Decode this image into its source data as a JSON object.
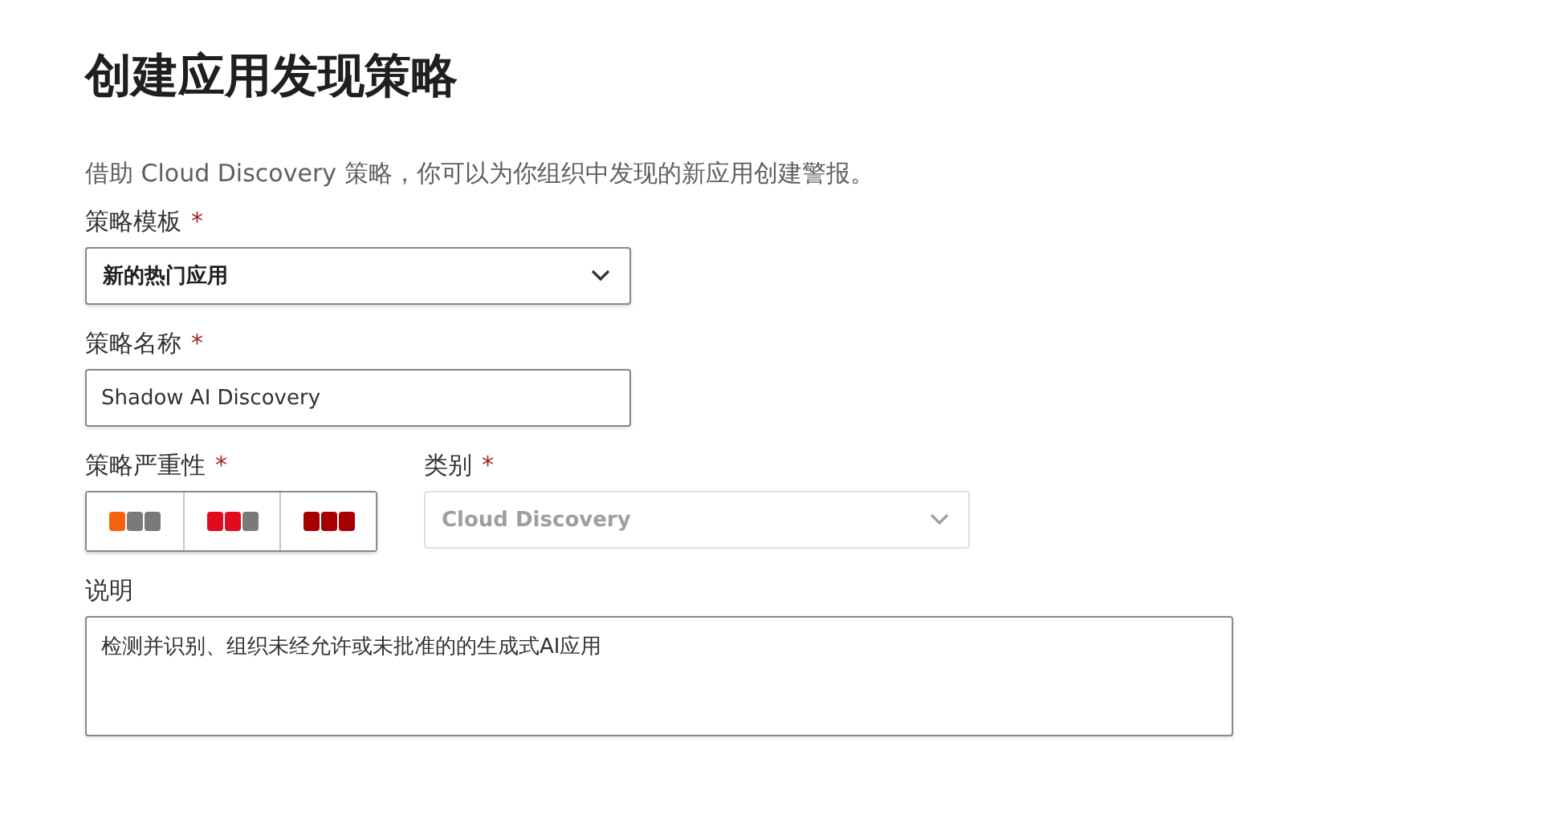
{
  "title": "创建应用发现策略",
  "intro": "借助 Cloud Discovery 策略，你可以为你组织中发现的新应用创建警报。",
  "template": {
    "label": "策略模板",
    "required_mark": "*",
    "value": "新的热门应用"
  },
  "name": {
    "label": "策略名称",
    "required_mark": "*",
    "value": "Shadow AI Discovery"
  },
  "severity": {
    "label": "策略严重性",
    "required_mark": "*",
    "options": [
      {
        "kind": "low",
        "selected": false
      },
      {
        "kind": "medium",
        "selected": false
      },
      {
        "kind": "high",
        "selected": false
      }
    ]
  },
  "category": {
    "label": "类别",
    "required_mark": "*",
    "value": "Cloud Discovery",
    "disabled": true
  },
  "description": {
    "label": "说明",
    "value": "检测并识别、组织未经允许或未批准的的生成式AI应用"
  }
}
